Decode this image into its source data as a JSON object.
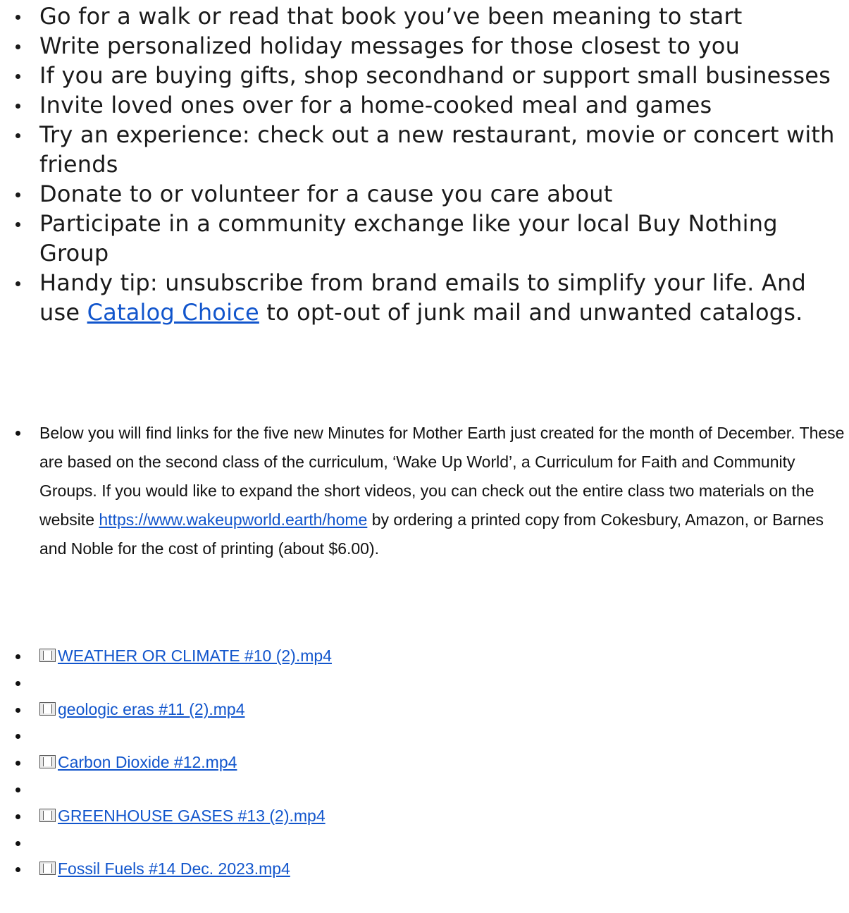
{
  "tips": [
    {
      "text": "Go for a walk or read that book you’ve been meaning to start"
    },
    {
      "text": "Write personalized holiday messages for those closest to you"
    },
    {
      "text": "If you are buying gifts, shop secondhand or support small businesses"
    },
    {
      "text": "Invite loved ones over for a home-cooked meal and games"
    },
    {
      "text": "Try an experience: check out a new restaurant, movie or concert with friends"
    },
    {
      "text": "Donate to or volunteer for a cause you care about"
    },
    {
      "text": "Participate in a community exchange like your local Buy Nothing Group"
    }
  ],
  "handy_tip": {
    "before": "Handy tip: unsubscribe from brand emails to simplify your life. And use ",
    "link": "Catalog Choice",
    "after": " to opt-out of junk mail and unwanted catalogs."
  },
  "intro": {
    "before": "Below you will find links for the five new Minutes for Mother Earth just created for the month of December.  These are based on the second class of the curriculum, ‘Wake Up World’, a Curriculum for Faith and Community Groups.  If you would like to expand the short videos, you can check out the entire class two materials on the website ",
    "url": "https://www.wakeupworld.earth/home",
    "after": "  by ordering a printed copy from Cokesbury, Amazon, or Barnes and Noble for the cost of printing (about $6.00)."
  },
  "videos": [
    {
      "label": "WEATHER OR CLIMATE #10 (2).mp4",
      "icon": "film-icon"
    },
    {
      "label": "geologic eras #11 (2).mp4",
      "icon": "film-icon"
    },
    {
      "label": "Carbon Dioxide #12.mp4",
      "icon": "film-icon"
    },
    {
      "label": "GREENHOUSE GASES #13 (2).mp4",
      "icon": "film-icon"
    },
    {
      "label": "Fossil Fuels #14 Dec. 2023.mp4",
      "icon": "film-icon"
    }
  ],
  "colors": {
    "link": "#1155cc",
    "text": "#1a1a1a"
  }
}
